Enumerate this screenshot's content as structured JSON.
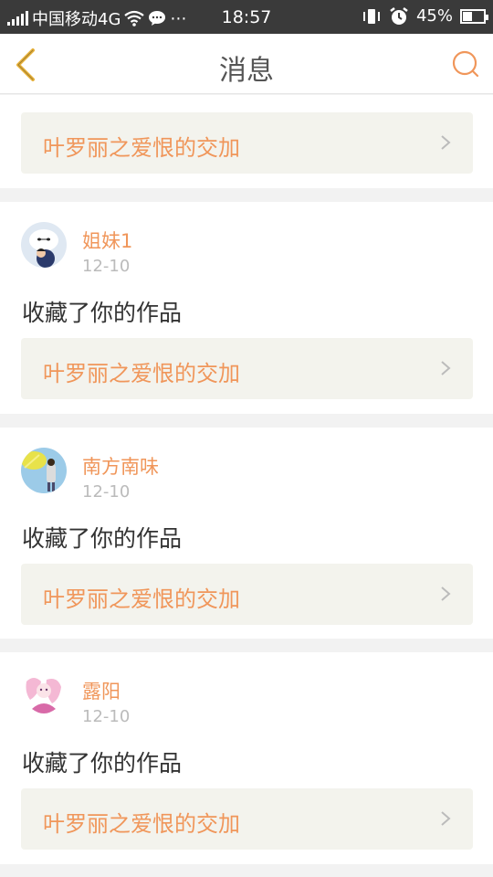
{
  "status_bar": {
    "carrier": "中国移动4G",
    "time": "18:57",
    "battery": "45%",
    "battery_level": 0.45
  },
  "header": {
    "title": "消息"
  },
  "first_item": {
    "work_title": "叶罗丽之爱恨的交加"
  },
  "messages": [
    {
      "name": "姐妹1",
      "date": "12-10",
      "action": "收藏了你的作品",
      "work_title": "叶罗丽之爱恨的交加"
    },
    {
      "name": "南方南味",
      "date": "12-10",
      "action": "收藏了你的作品",
      "work_title": "叶罗丽之爱恨的交加"
    },
    {
      "name": "露阳",
      "date": "12-10",
      "action": "收藏了你的作品",
      "work_title": "叶罗丽之爱恨的交加"
    }
  ],
  "colors": {
    "accent": "#f0965a",
    "back_arrow": "#e8b23c",
    "status_bar": "#3a3a3a"
  }
}
